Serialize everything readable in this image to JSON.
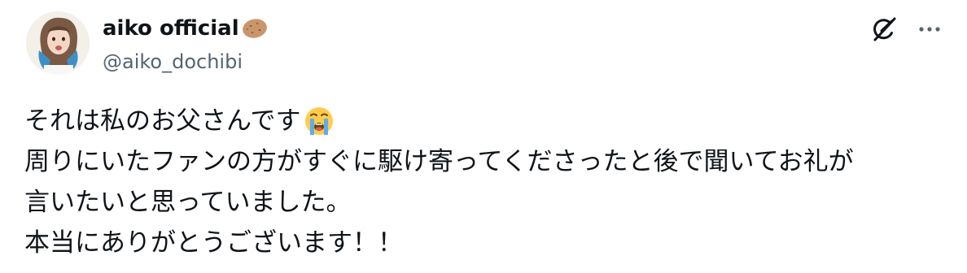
{
  "account": {
    "display_name": "aiko official",
    "handle": "@aiko_dochibi",
    "avatar_icon": "profile-photo",
    "name_emoji_icon": "potato-emoji-icon"
  },
  "actions": {
    "grok_icon": "grok-icon",
    "more_icon": "more-options-icon"
  },
  "tweet": {
    "lines": [
      "それは私のお父さんです",
      "周りにいたファンの方がすぐに駆け寄ってくださったと後で聞いてお礼が",
      "言いたいと思っていました。",
      "本当にありがとうございます！！"
    ],
    "line1_emoji_icon": "loudly-crying-face-emoji-icon"
  },
  "colors": {
    "text_primary": "#0f1419",
    "text_secondary": "#536471"
  }
}
